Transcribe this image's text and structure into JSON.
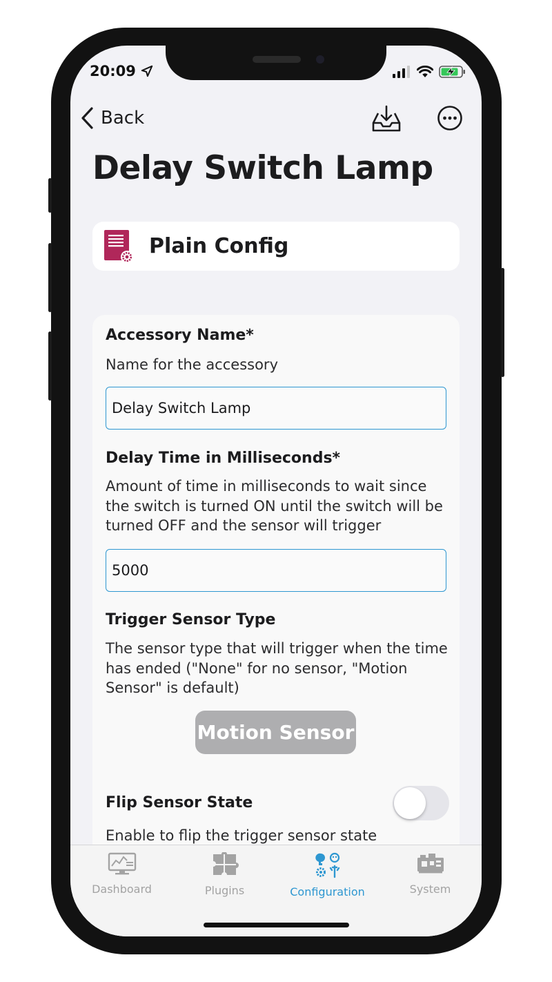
{
  "status_bar": {
    "time": "20:09"
  },
  "nav": {
    "back_label": "Back"
  },
  "page": {
    "title": "Delay Switch Lamp"
  },
  "plugin": {
    "name": "Plain Config",
    "icon": "config-document-gear-icon",
    "icon_color": "#b0275a"
  },
  "form": {
    "accessory_name": {
      "label": "Accessory Name*",
      "description": "Name for the accessory",
      "value": "Delay Switch Lamp"
    },
    "delay_time": {
      "label": "Delay Time in Milliseconds*",
      "description": "Amount of time in milliseconds to wait since the switch is turned ON until the switch will be turned OFF and the sensor will trigger",
      "value": "5000"
    },
    "trigger_sensor_type": {
      "label": "Trigger Sensor Type",
      "description": "The sensor type that will trigger when the time has ended (\"None\" for no sensor, \"Motion Sensor\" is default)",
      "selected": "Motion Sensor"
    },
    "flip_sensor_state": {
      "label": "Flip Sensor State",
      "description": "Enable to flip the trigger sensor state",
      "enabled": false
    }
  },
  "tabs": [
    {
      "label": "Dashboard",
      "icon": "dashboard-icon",
      "active": false
    },
    {
      "label": "Plugins",
      "icon": "plugins-puzzle-icon",
      "active": false
    },
    {
      "label": "Configuration",
      "icon": "configuration-icon",
      "active": true
    },
    {
      "label": "System",
      "icon": "system-board-icon",
      "active": false
    }
  ],
  "colors": {
    "accent": "#2e97d1",
    "inactive_tab": "#a3a3a3",
    "select_bg": "#aeaeb0"
  }
}
